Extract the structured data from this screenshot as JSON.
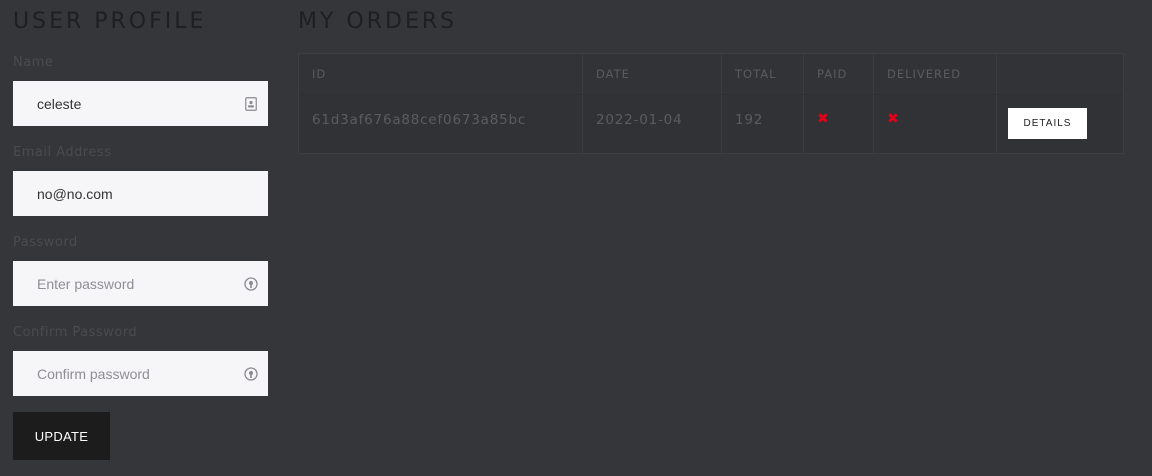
{
  "profile": {
    "title": "USER PROFILE",
    "fields": {
      "name": {
        "label": "Name",
        "value": "celeste",
        "icon": "contact-card-icon"
      },
      "email": {
        "label": "Email Address",
        "value": "no@no.com"
      },
      "password": {
        "label": "Password",
        "placeholder": "Enter password",
        "icon": "password-manager-icon"
      },
      "confirm": {
        "label": "Confirm Password",
        "placeholder": "Confirm password",
        "icon": "password-manager-icon"
      }
    },
    "update_label": "UPDATE"
  },
  "orders": {
    "title": "MY ORDERS",
    "columns": [
      "ID",
      "DATE",
      "TOTAL",
      "PAID",
      "DELIVERED",
      ""
    ],
    "rows": [
      {
        "id": "61d3af676a88cef0673a85bc",
        "date": "2022-01-04",
        "total": "192",
        "paid": "false",
        "delivered": "false",
        "action_label": "DETAILS"
      }
    ],
    "status_colors": {
      "not_done": "#e0001a"
    }
  }
}
